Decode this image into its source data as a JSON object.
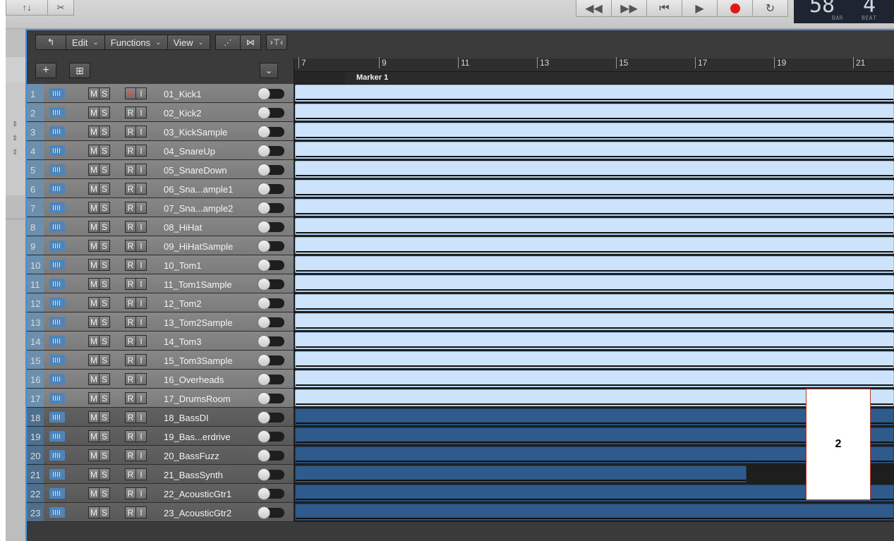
{
  "topbar": {
    "left_label_1": "↑↓",
    "left_label_2": "✂"
  },
  "lcd": {
    "bar_value": "58",
    "beat_value": "4",
    "bar_label": "BAR",
    "beat_label": "BEAT"
  },
  "menubar": {
    "back_symbol": "↰",
    "edit": "Edit",
    "functions": "Functions",
    "view": "View"
  },
  "header": {
    "add_symbol": "+",
    "global_symbol": "⊞",
    "collapse_symbol": "⌄"
  },
  "ruler": {
    "bars": [
      "7",
      "9",
      "11",
      "13",
      "15",
      "17",
      "19",
      "21"
    ]
  },
  "marker": {
    "label": "Marker 1"
  },
  "tracks": [
    {
      "num": "1",
      "name": "01_Kick1",
      "m": "M",
      "s": "S",
      "r": "R",
      "i": "I"
    },
    {
      "num": "2",
      "name": "02_Kick2",
      "m": "M",
      "s": "S",
      "r": "R",
      "i": "I"
    },
    {
      "num": "3",
      "name": "03_KickSample",
      "m": "M",
      "s": "S",
      "r": "R",
      "i": "I"
    },
    {
      "num": "4",
      "name": "04_SnareUp",
      "m": "M",
      "s": "S",
      "r": "R",
      "i": "I"
    },
    {
      "num": "5",
      "name": "05_SnareDown",
      "m": "M",
      "s": "S",
      "r": "R",
      "i": "I"
    },
    {
      "num": "6",
      "name": "06_Sna...ample1",
      "m": "M",
      "s": "S",
      "r": "R",
      "i": "I"
    },
    {
      "num": "7",
      "name": "07_Sna...ample2",
      "m": "M",
      "s": "S",
      "r": "R",
      "i": "I"
    },
    {
      "num": "8",
      "name": "08_HiHat",
      "m": "M",
      "s": "S",
      "r": "R",
      "i": "I"
    },
    {
      "num": "9",
      "name": "09_HiHatSample",
      "m": "M",
      "s": "S",
      "r": "R",
      "i": "I"
    },
    {
      "num": "10",
      "name": "10_Tom1",
      "m": "M",
      "s": "S",
      "r": "R",
      "i": "I"
    },
    {
      "num": "11",
      "name": "11_Tom1Sample",
      "m": "M",
      "s": "S",
      "r": "R",
      "i": "I"
    },
    {
      "num": "12",
      "name": "12_Tom2",
      "m": "M",
      "s": "S",
      "r": "R",
      "i": "I"
    },
    {
      "num": "13",
      "name": "13_Tom2Sample",
      "m": "M",
      "s": "S",
      "r": "R",
      "i": "I"
    },
    {
      "num": "14",
      "name": "14_Tom3",
      "m": "M",
      "s": "S",
      "r": "R",
      "i": "I"
    },
    {
      "num": "15",
      "name": "15_Tom3Sample",
      "m": "M",
      "s": "S",
      "r": "R",
      "i": "I"
    },
    {
      "num": "16",
      "name": "16_Overheads",
      "m": "M",
      "s": "S",
      "r": "R",
      "i": "I"
    },
    {
      "num": "17",
      "name": "17_DrumsRoom",
      "m": "M",
      "s": "S",
      "r": "R",
      "i": "I"
    },
    {
      "num": "18",
      "name": "18_BassDI",
      "m": "M",
      "s": "S",
      "r": "R",
      "i": "I"
    },
    {
      "num": "19",
      "name": "19_Bas...erdrive",
      "m": "M",
      "s": "S",
      "r": "R",
      "i": "I"
    },
    {
      "num": "20",
      "name": "20_BassFuzz",
      "m": "M",
      "s": "S",
      "r": "R",
      "i": "I"
    },
    {
      "num": "21",
      "name": "21_BassSynth",
      "m": "M",
      "s": "S",
      "r": "R",
      "i": "I"
    },
    {
      "num": "22",
      "name": "22_AcousticGtr1",
      "m": "M",
      "s": "S",
      "r": "R",
      "i": "I"
    },
    {
      "num": "23",
      "name": "23_AcousticGtr2",
      "m": "M",
      "s": "S",
      "r": "R",
      "i": "I"
    }
  ],
  "overlay": {
    "label": "2"
  },
  "colors": {
    "region_light": "#cbe3fb",
    "region_dark": "#2f5b8b",
    "record_red": "#e01818",
    "selection_blue": "#4a90d9"
  }
}
